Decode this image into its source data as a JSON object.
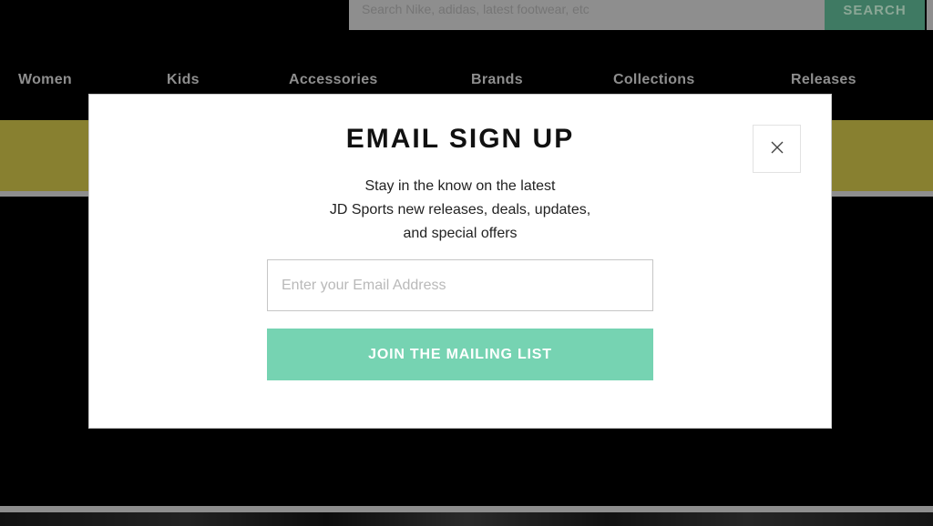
{
  "header": {
    "search": {
      "placeholder": "Search Nike, adidas, latest footwear, etc",
      "button_label": "SEARCH"
    }
  },
  "nav": {
    "items": [
      {
        "label": "Women"
      },
      {
        "label": "Kids"
      },
      {
        "label": "Accessories"
      },
      {
        "label": "Brands"
      },
      {
        "label": "Collections"
      },
      {
        "label": "Releases"
      }
    ]
  },
  "colors": {
    "accent": "#76d3b2",
    "banner": "#888030",
    "overlay": "#000000"
  },
  "modal": {
    "title": "EMAIL SIGN UP",
    "copy_lines": [
      "Stay in the know on the latest",
      "JD Sports new releases, deals, updates,",
      "and special offers"
    ],
    "email_placeholder": "Enter your Email Address",
    "email_value": "",
    "submit_label": "JOIN THE MAILING LIST",
    "close_icon": "close-icon"
  }
}
